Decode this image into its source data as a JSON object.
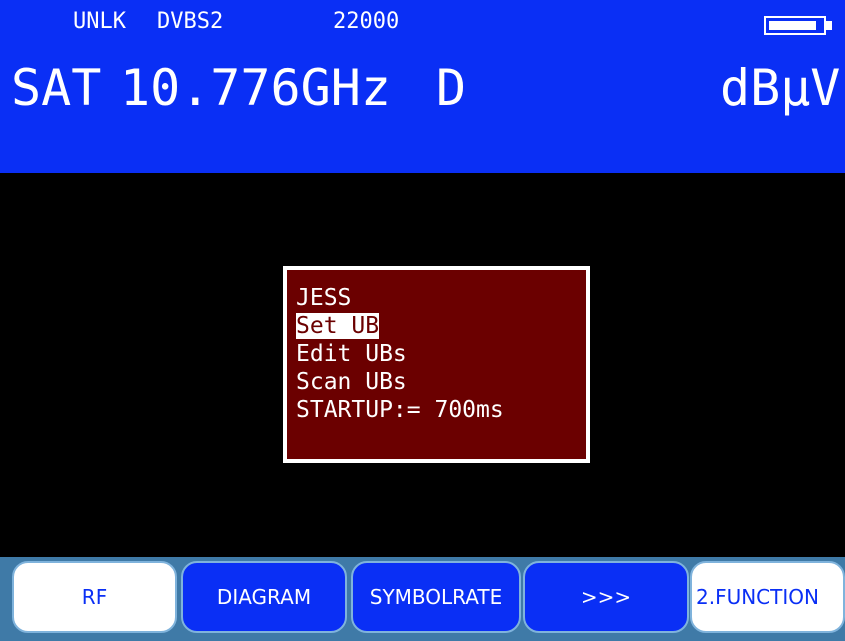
{
  "status": {
    "lock": "UNLK",
    "mode": "DVBS2",
    "symbolrate": "22000",
    "battery_level": 0.9
  },
  "main": {
    "band": "SAT",
    "frequency": "10.776GHz",
    "polarization": "D",
    "unit": "dBµV"
  },
  "menu": {
    "items": [
      {
        "label": "JESS"
      },
      {
        "label": "Set UB"
      },
      {
        "label": "Edit UBs"
      },
      {
        "label": "Scan UBs"
      },
      {
        "label": "STARTUP:= 700ms"
      }
    ]
  },
  "softkeys": [
    {
      "label": "RF"
    },
    {
      "label": "DIAGRAM"
    },
    {
      "label": "SYMBOLRATE"
    },
    {
      "label": ">>>"
    },
    {
      "label": "2.FUNCTION"
    }
  ],
  "colors": {
    "header_blue": "#0a2ff5",
    "menu_red": "#6b0000",
    "footer": "#3f7aa7"
  }
}
